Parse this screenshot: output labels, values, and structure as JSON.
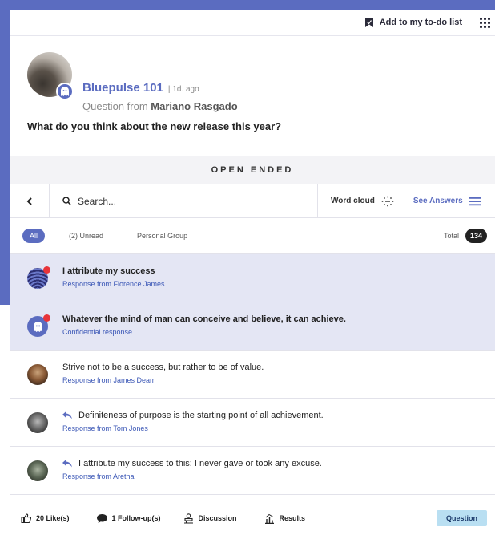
{
  "topbar": {
    "todo_label": "Add to my to-do list"
  },
  "header": {
    "app_title": "Bluepulse 101",
    "time": "| 1d. ago",
    "question_from_prefix": "Question from",
    "question_from_name": "Mariano Rasgado"
  },
  "question": "What do you think about the new release this year?",
  "question_type": "OPEN ENDED",
  "search": {
    "placeholder": "Search...",
    "word_cloud_label": "Word cloud",
    "see_answers_label": "See Answers"
  },
  "filters": {
    "all": "All",
    "unread": "(2) Unread",
    "group": "Personal Group",
    "total_label": "Total",
    "total_count": "134"
  },
  "responses": [
    {
      "text": "I attribute my success",
      "meta": "Response from Florence James",
      "unread": true
    },
    {
      "text": "Whatever the mind of man can conceive and believe, it can achieve.",
      "meta": "Confidential response",
      "unread": true
    },
    {
      "text": "Strive not to be a success, but rather to be of value.",
      "meta": "Response from James Deam",
      "unread": false
    },
    {
      "text": "Definiteness of purpose is the starting point of all achievement.",
      "meta": "Response from Tom Jones",
      "unread": false,
      "replied": true
    },
    {
      "text": "I attribute my success to this: I never gave or took any excuse.",
      "meta": "Response from Aretha",
      "unread": false,
      "replied": true
    }
  ],
  "footer": {
    "likes": "20 Like(s)",
    "followups": "1 Follow-up(s)",
    "discussion": "Discussion",
    "results": "Results",
    "question_button": "Question"
  },
  "colors": {
    "accent": "#5b6cc0",
    "unread_bg": "#e4e6f4",
    "dot": "#e8343a",
    "question_button": "#b9dff2"
  }
}
